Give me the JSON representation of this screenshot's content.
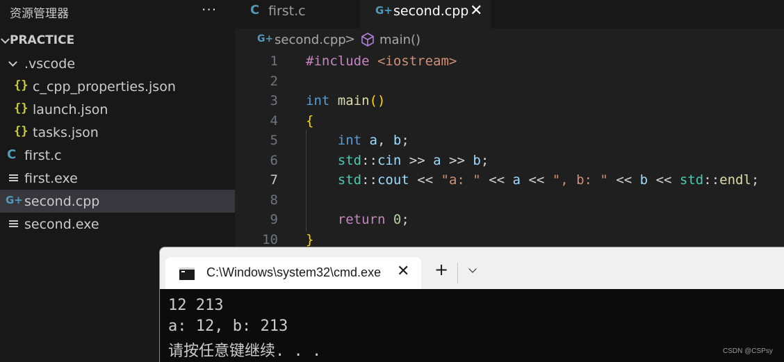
{
  "sidebar": {
    "title": "资源管理器",
    "more_label": "···",
    "folder": "PRACTICE",
    "items": [
      {
        "label": ".vscode",
        "icon": "chevron-down"
      },
      {
        "label": "c_cpp_properties.json",
        "icon": "json-braces"
      },
      {
        "label": "launch.json",
        "icon": "json-braces"
      },
      {
        "label": "tasks.json",
        "icon": "json-braces"
      },
      {
        "label": "first.c",
        "icon": "c-file"
      },
      {
        "label": "first.exe",
        "icon": "exe-file"
      },
      {
        "label": "second.cpp",
        "icon": "cpp-file",
        "selected": true
      },
      {
        "label": "second.exe",
        "icon": "exe-file"
      }
    ]
  },
  "icons": {
    "braces": "{}",
    "c": "C",
    "cpp": "G+",
    "close": "✕",
    "plus": "+"
  },
  "tabs": [
    {
      "label": "first.c",
      "active": false
    },
    {
      "label": "second.cpp",
      "active": true
    }
  ],
  "breadcrumb": {
    "file": "second.cpp",
    "separator": ">",
    "symbol": "main()"
  },
  "editor": {
    "active_line": 7,
    "line_numbers": [
      "1",
      "2",
      "3",
      "4",
      "5",
      "6",
      "7",
      "8",
      "9",
      "10"
    ]
  },
  "terminal": {
    "tab_title": "C:\\Windows\\system32\\cmd.exe",
    "output": [
      "12 213",
      "a: 12, b: 213",
      "请按任意键继续. . ."
    ]
  },
  "watermark": "CSDN @CSPsy",
  "colors": {
    "sidebar_bg": "#181818",
    "editor_bg": "#1f1f1f",
    "selected_row": "#37373d",
    "keyword": "#569cd6",
    "string": "#ce9178",
    "accent_cpp": "#519aba",
    "json_icon": "#cbcb41"
  }
}
